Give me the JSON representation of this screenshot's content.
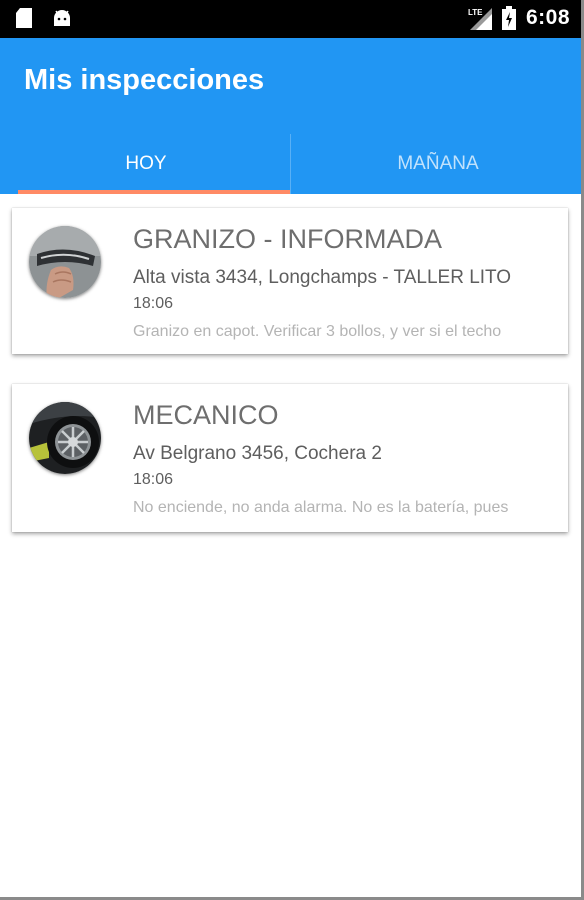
{
  "status_bar": {
    "time": "6:08",
    "network_label": "LTE",
    "left_icons": [
      "sd-card-icon",
      "android-icon"
    ],
    "right_icons": [
      "signal-icon",
      "battery-icon"
    ]
  },
  "app_bar": {
    "title": "Mis inspecciones",
    "color": "#2196f3"
  },
  "tabs": [
    {
      "label": "HOY",
      "selected": true
    },
    {
      "label": "MAÑANA",
      "selected": false
    }
  ],
  "tab_indicator_color": "#ff8a65",
  "inspections": [
    {
      "title": "GRANIZO - INFORMADA",
      "address": "Alta vista 3434, Longchamps - TALLER LITO",
      "time": "18:06",
      "description": "Granizo en capot. Verificar 3 bollos, y ver si el techo",
      "thumbnail_icon": "car-door-handle-photo"
    },
    {
      "title": "MECANICO",
      "address": "Av Belgrano 3456, Cochera 2",
      "time": "18:06",
      "description": "No enciende, no anda alarma. No es la batería, pues",
      "thumbnail_icon": "car-wheel-photo"
    }
  ]
}
